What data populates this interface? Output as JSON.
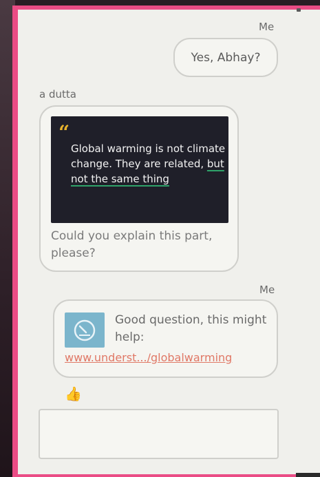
{
  "conversation": {
    "messages": [
      {
        "sender": "Me",
        "text": "Yes, Abhay?"
      },
      {
        "sender": "a dutta",
        "quote_text_a": "Global warming is not climate change. They are related, ",
        "quote_text_b": "but not the same thing",
        "caption": "Could you explain this part, please?"
      },
      {
        "sender": "Me",
        "text": "Good question, this might help:",
        "link": "www.underst.../globalwarming",
        "icon": "gauge-icon"
      }
    ],
    "reaction": "👍"
  },
  "input": {
    "value": ""
  },
  "colors": {
    "frame": "#ea4c85",
    "link": "#e07866",
    "quote_mark": "#e8b32c",
    "underline": "#2fa36a",
    "icon_bg": "#7bb5cc"
  }
}
